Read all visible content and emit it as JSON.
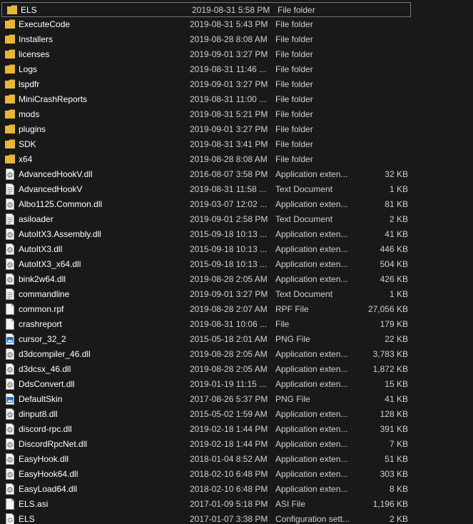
{
  "colors": {
    "background": "#191919",
    "folder": "#e8b739",
    "selection_border": "#767676",
    "text_primary": "#ffffff",
    "text_secondary": "#d0d0d0"
  },
  "files": [
    {
      "name": "ELS",
      "date": "2019-08-31 5:58 PM",
      "type": "File folder",
      "size": "",
      "icon": "folder-icon",
      "selected": true
    },
    {
      "name": "ExecuteCode",
      "date": "2019-08-31 5:43 PM",
      "type": "File folder",
      "size": "",
      "icon": "folder-icon"
    },
    {
      "name": "Installers",
      "date": "2019-08-28 8:08 AM",
      "type": "File folder",
      "size": "",
      "icon": "folder-icon"
    },
    {
      "name": "licenses",
      "date": "2019-09-01 3:27 PM",
      "type": "File folder",
      "size": "",
      "icon": "folder-icon"
    },
    {
      "name": "Logs",
      "date": "2019-08-31 11:46 ...",
      "type": "File folder",
      "size": "",
      "icon": "folder-icon"
    },
    {
      "name": "lspdfr",
      "date": "2019-09-01 3:27 PM",
      "type": "File folder",
      "size": "",
      "icon": "folder-icon"
    },
    {
      "name": "MiniCrashReports",
      "date": "2019-08-31 11:00 ...",
      "type": "File folder",
      "size": "",
      "icon": "folder-icon"
    },
    {
      "name": "mods",
      "date": "2019-08-31 5:21 PM",
      "type": "File folder",
      "size": "",
      "icon": "folder-icon"
    },
    {
      "name": "plugins",
      "date": "2019-09-01 3:27 PM",
      "type": "File folder",
      "size": "",
      "icon": "folder-icon"
    },
    {
      "name": "SDK",
      "date": "2019-08-31 3:41 PM",
      "type": "File folder",
      "size": "",
      "icon": "folder-icon"
    },
    {
      "name": "x64",
      "date": "2019-08-28 8:08 AM",
      "type": "File folder",
      "size": "",
      "icon": "folder-icon"
    },
    {
      "name": "AdvancedHookV.dll",
      "date": "2016-08-07 3:58 PM",
      "type": "Application exten...",
      "size": "32 KB",
      "icon": "dll-file-icon"
    },
    {
      "name": "AdvancedHookV",
      "date": "2019-08-31 11:58 ...",
      "type": "Text Document",
      "size": "1 KB",
      "icon": "text-file-icon"
    },
    {
      "name": "Albo1125.Common.dll",
      "date": "2019-03-07 12:02 ...",
      "type": "Application exten...",
      "size": "81 KB",
      "icon": "dll-file-icon"
    },
    {
      "name": "asiloader",
      "date": "2019-09-01 2:58 PM",
      "type": "Text Document",
      "size": "2 KB",
      "icon": "text-file-icon"
    },
    {
      "name": "AutoItX3.Assembly.dll",
      "date": "2015-09-18 10:13 ...",
      "type": "Application exten...",
      "size": "41 KB",
      "icon": "dll-file-icon"
    },
    {
      "name": "AutoItX3.dll",
      "date": "2015-09-18 10:13 ...",
      "type": "Application exten...",
      "size": "446 KB",
      "icon": "dll-file-icon"
    },
    {
      "name": "AutoItX3_x64.dll",
      "date": "2015-09-18 10:13 ...",
      "type": "Application exten...",
      "size": "504 KB",
      "icon": "dll-file-icon"
    },
    {
      "name": "bink2w64.dll",
      "date": "2019-08-28 2:05 AM",
      "type": "Application exten...",
      "size": "426 KB",
      "icon": "dll-file-icon"
    },
    {
      "name": "commandline",
      "date": "2019-09-01 3:27 PM",
      "type": "Text Document",
      "size": "1 KB",
      "icon": "text-file-icon"
    },
    {
      "name": "common.rpf",
      "date": "2019-08-28 2:07 AM",
      "type": "RPF File",
      "size": "27,056 KB",
      "icon": "blank-file-icon"
    },
    {
      "name": "crashreport",
      "date": "2019-08-31 10:06 ...",
      "type": "File",
      "size": "179 KB",
      "icon": "blank-file-icon"
    },
    {
      "name": "cursor_32_2",
      "date": "2015-05-18 2:01 AM",
      "type": "PNG File",
      "size": "22 KB",
      "icon": "image-file-icon"
    },
    {
      "name": "d3dcompiler_46.dll",
      "date": "2019-08-28 2:05 AM",
      "type": "Application exten...",
      "size": "3,783 KB",
      "icon": "dll-file-icon"
    },
    {
      "name": "d3dcsx_46.dll",
      "date": "2019-08-28 2:05 AM",
      "type": "Application exten...",
      "size": "1,872 KB",
      "icon": "dll-file-icon"
    },
    {
      "name": "DdsConvert.dll",
      "date": "2019-01-19 11:15 ...",
      "type": "Application exten...",
      "size": "15 KB",
      "icon": "dll-file-icon"
    },
    {
      "name": "DefaultSkin",
      "date": "2017-08-26 5:37 PM",
      "type": "PNG File",
      "size": "41 KB",
      "icon": "image-file-icon"
    },
    {
      "name": "dinput8.dll",
      "date": "2015-05-02 1:59 AM",
      "type": "Application exten...",
      "size": "128 KB",
      "icon": "dll-file-icon"
    },
    {
      "name": "discord-rpc.dll",
      "date": "2019-02-18 1:44 PM",
      "type": "Application exten...",
      "size": "391 KB",
      "icon": "dll-file-icon"
    },
    {
      "name": "DiscordRpcNet.dll",
      "date": "2019-02-18 1:44 PM",
      "type": "Application exten...",
      "size": "7 KB",
      "icon": "dll-file-icon"
    },
    {
      "name": "EasyHook.dll",
      "date": "2018-01-04 8:52 AM",
      "type": "Application exten...",
      "size": "51 KB",
      "icon": "dll-file-icon"
    },
    {
      "name": "EasyHook64.dll",
      "date": "2018-02-10 6:48 PM",
      "type": "Application exten...",
      "size": "303 KB",
      "icon": "dll-file-icon"
    },
    {
      "name": "EasyLoad64.dll",
      "date": "2018-02-10 6:48 PM",
      "type": "Application exten...",
      "size": "8 KB",
      "icon": "dll-file-icon"
    },
    {
      "name": "ELS.asi",
      "date": "2017-01-09 5:18 PM",
      "type": "ASI File",
      "size": "1,196 KB",
      "icon": "blank-file-icon"
    },
    {
      "name": "ELS",
      "date": "2017-01-07 3:38 PM",
      "type": "Configuration sett...",
      "size": "2 KB",
      "icon": "config-file-icon"
    }
  ]
}
